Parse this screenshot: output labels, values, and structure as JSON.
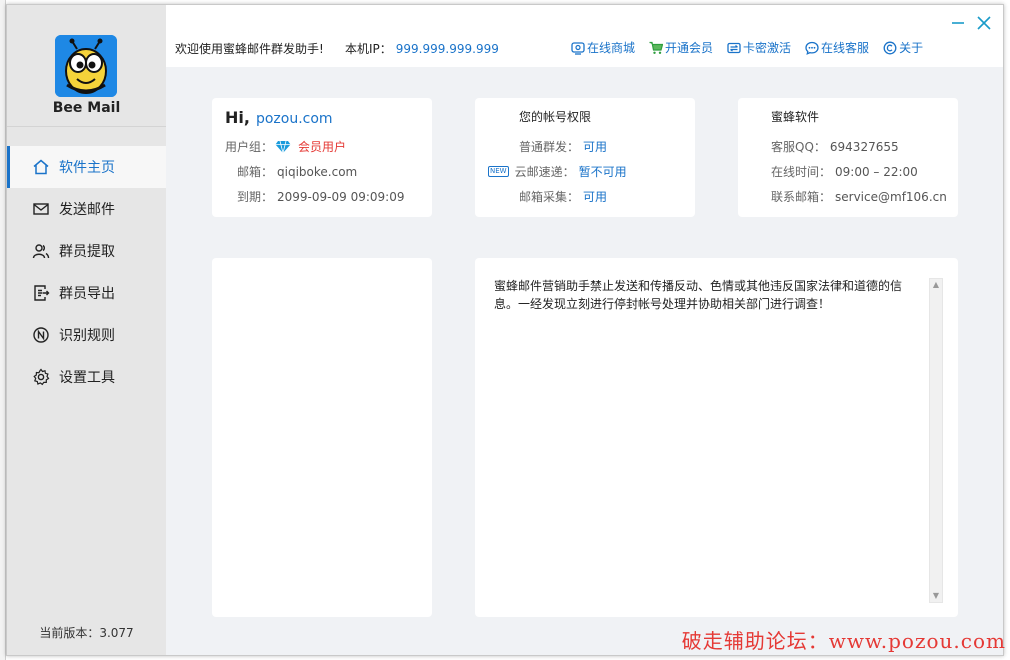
{
  "app": {
    "name": "Bee Mail",
    "version_label": "当前版本：3.077"
  },
  "nav": [
    {
      "label": "软件主页",
      "icon": "home-icon",
      "active": true
    },
    {
      "label": "发送邮件",
      "icon": "mail-icon",
      "active": false
    },
    {
      "label": "群员提取",
      "icon": "users-icon",
      "active": false
    },
    {
      "label": "群员导出",
      "icon": "export-icon",
      "active": false
    },
    {
      "label": "识别规则",
      "icon": "rule-icon",
      "active": false
    },
    {
      "label": "设置工具",
      "icon": "gear-icon",
      "active": false
    }
  ],
  "topbar": {
    "welcome": "欢迎使用蜜蜂邮件群发助手!",
    "ip_label": "本机IP：",
    "ip_value": "999.999.999.999",
    "links": [
      {
        "label": "在线商城",
        "icon": "shop-icon"
      },
      {
        "label": "开通会员",
        "icon": "cart-icon"
      },
      {
        "label": "卡密激活",
        "icon": "card-icon"
      },
      {
        "label": "在线客服",
        "icon": "chat-icon"
      },
      {
        "label": "关于",
        "icon": "copyright-icon"
      }
    ]
  },
  "user_card": {
    "greeting": "Hi,",
    "username": "pozou.com",
    "group_label": "用户组：",
    "group_value": "会员用户",
    "email_label": "邮箱：",
    "email_value": "qiqiboke.com",
    "expire_label": "到期：",
    "expire_value": "2099-09-09 09:09:09"
  },
  "perm_card": {
    "title": "您的帐号权限",
    "rows": [
      {
        "label": "普通群发：",
        "value": "可用",
        "new": false
      },
      {
        "label": "云邮速递：",
        "value": "暂不可用",
        "new": true
      },
      {
        "label": "邮箱采集：",
        "value": "可用",
        "new": false
      }
    ],
    "new_badge": "NEW"
  },
  "info_card": {
    "title": "蜜蜂软件",
    "rows": [
      {
        "label": "客服QQ：",
        "value": "694327655"
      },
      {
        "label": "在线时间：",
        "value": "09:00 – 22:00"
      },
      {
        "label": "联系邮箱：",
        "value": "service@mf106.cn"
      }
    ]
  },
  "notice": {
    "text": "蜜蜂邮件营销助手禁止发送和传播反动、色情或其他违反国家法律和道德的信息。一经发现立刻进行停封帐号处理并协助相关部门进行调查！"
  },
  "watermark": "破走辅助论坛：www.pozou.com",
  "colors": {
    "accent": "#1a73c9",
    "sidebar_bg": "#e6e6e6",
    "main_bg": "#f0f2f5",
    "danger": "#e53935"
  }
}
